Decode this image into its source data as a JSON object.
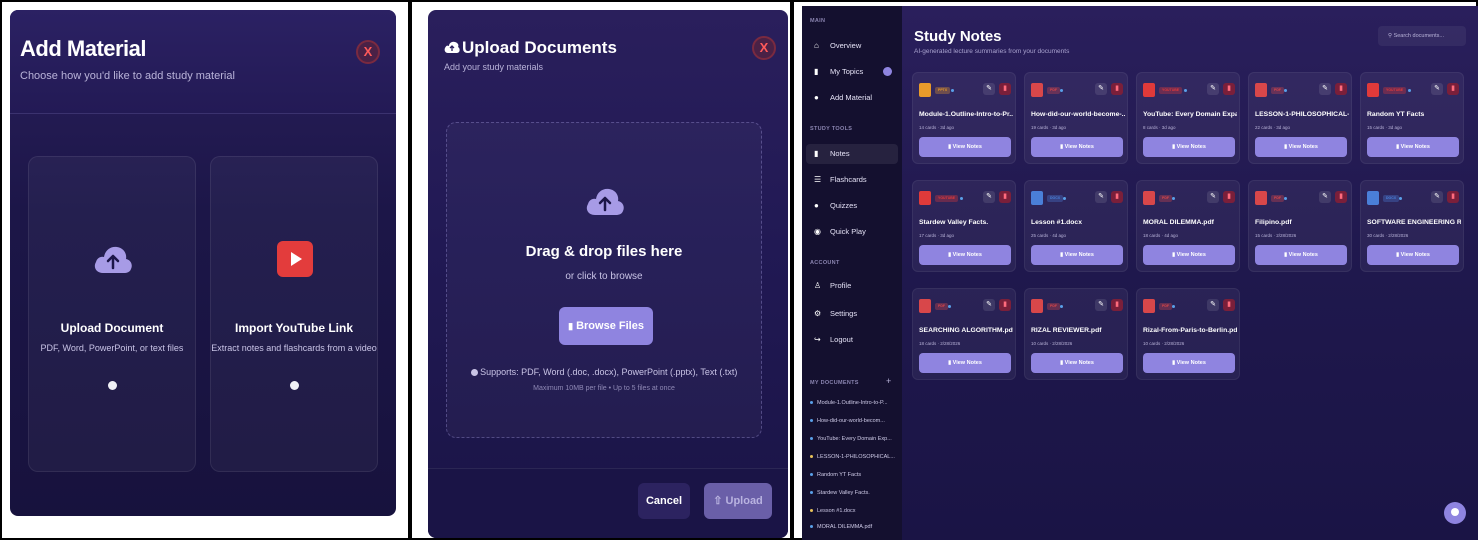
{
  "add_material": {
    "title": "Add Material",
    "subtitle": "Choose how you'd like to add study material",
    "close": "X",
    "options": [
      {
        "label": "Upload Document",
        "desc": "PDF, Word, PowerPoint, or text files"
      },
      {
        "label": "Import YouTube Link",
        "desc": "Extract notes and flashcards from a video"
      }
    ]
  },
  "upload_docs": {
    "title": "Upload Documents",
    "subtitle": "Add your study materials",
    "close": "X",
    "drop_title": "Drag & drop files here",
    "drop_sub": "or click to browse",
    "browse": "Browse Files",
    "supports": "Supports: PDF, Word (.doc, .docx), PowerPoint (.pptx), Text (.txt)",
    "max": "Maximum 10MB per file • Up to 5 files at once",
    "cancel": "Cancel",
    "upload": "Upload"
  },
  "study": {
    "sidebar": {
      "main_label": "MAIN",
      "study_tools_label": "STUDY TOOLS",
      "account_label": "ACCOUNT",
      "my_documents_label": "MY DOCUMENTS",
      "add_doc": "+",
      "main_items": [
        "Overview",
        "My Topics",
        "Add Material"
      ],
      "tool_items": [
        "Notes",
        "Flashcards",
        "Quizzes",
        "Quick Play"
      ],
      "account_items": [
        "Profile",
        "Settings",
        "Logout"
      ],
      "documents": [
        "Module-1.Outline-Intro-to-P...",
        "How-did-our-world-becom...",
        "YouTube: Every Domain Exp...",
        "LESSON-1-PHILOSOPHICAL...",
        "Random YT Facts",
        "Stardew Valley Facts.",
        "Lesson #1.docx",
        "MORAL DILEMMA.pdf"
      ]
    },
    "title": "Study Notes",
    "subtitle": "AI-generated lecture summaries from your documents",
    "search_placeholder": "Search documents...",
    "view_notes": "View Notes",
    "notes": [
      {
        "type": "PPTX",
        "title": "Module-1.Outline-Intro-to-Pr...",
        "meta": "14 cards · 3d ago"
      },
      {
        "type": "PDF",
        "title": "How-did-our-world-become-...",
        "meta": "19 cards · 3d ago"
      },
      {
        "type": "YOUTUBE",
        "title": "YouTube: Every Domain Expa...",
        "meta": "8 cards · 3d ago"
      },
      {
        "type": "PDF",
        "title": "LESSON-1-PHILOSOPHICAL-...",
        "meta": "22 cards · 3d ago"
      },
      {
        "type": "YOUTUBE",
        "title": "Random YT Facts",
        "meta": "15 cards · 3d ago"
      },
      {
        "type": "YOUTUBE",
        "title": "Stardew Valley Facts.",
        "meta": "17 cards · 3d ago"
      },
      {
        "type": "DOCX",
        "title": "Lesson #1.docx",
        "meta": "25 cards · 4d ago"
      },
      {
        "type": "PDF",
        "title": "MORAL DILEMMA.pdf",
        "meta": "18 cards · 4d ago"
      },
      {
        "type": "PDF",
        "title": "Filipino.pdf",
        "meta": "15 cards · 2/28/2026"
      },
      {
        "type": "DOCX",
        "title": "SOFTWARE ENGINEERING RE...",
        "meta": "30 cards · 2/28/2026"
      },
      {
        "type": "PDF",
        "title": "SEARCHING ALGORITHM.pdf",
        "meta": "18 cards · 2/28/2026"
      },
      {
        "type": "PDF",
        "title": "RIZAL REVIEWER.pdf",
        "meta": "10 cards · 2/28/2026"
      },
      {
        "type": "PDF",
        "title": "Rizal-From-Paris-to-Berlin.pdf",
        "meta": "10 cards · 2/28/2026"
      }
    ],
    "colors": {
      "pdf": "#d8474a",
      "youtube": "#e03a3a",
      "pptx": "#e89a2a",
      "docx": "#4a7fd8",
      "accent": "#8f84e0"
    }
  }
}
